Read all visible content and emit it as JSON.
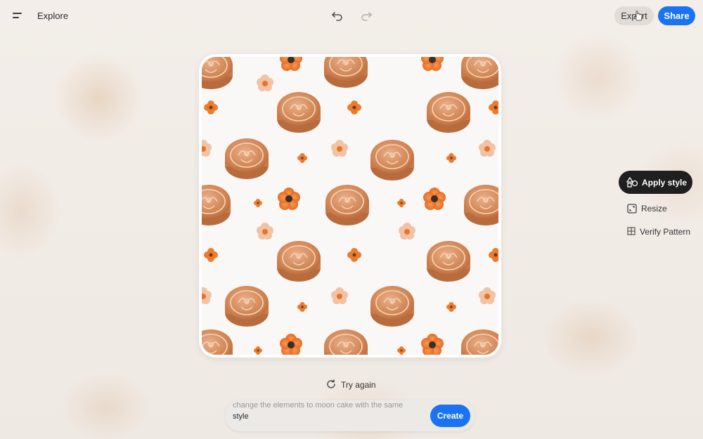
{
  "header": {
    "menu_icon": "menu-icon",
    "title": "Explore",
    "undo_icon": "undo-icon",
    "redo_icon": "redo-icon",
    "export_label": "Export",
    "share_label": "Share"
  },
  "canvas": {
    "pattern_motifs": [
      "mooncake",
      "orange-flower",
      "peach-blossom"
    ]
  },
  "side_menu": {
    "apply_style": {
      "label": "Apply style",
      "icon": "shapes-icon"
    },
    "resize": {
      "label": "Resize",
      "icon": "resize-icon"
    },
    "verify_pattern": {
      "label": "Verify Pattern",
      "icon": "grid-icon"
    }
  },
  "try_again": {
    "label": "Try again",
    "icon": "refresh-icon"
  },
  "prompt": {
    "line1": "change the elements to moon cake with the same",
    "line2": "style",
    "create_label": "Create"
  },
  "colors": {
    "accent": "#1a73f2",
    "dark_button": "#1f1f1f",
    "mooncake": "#d9956a",
    "flower": "#ef7a2a"
  }
}
